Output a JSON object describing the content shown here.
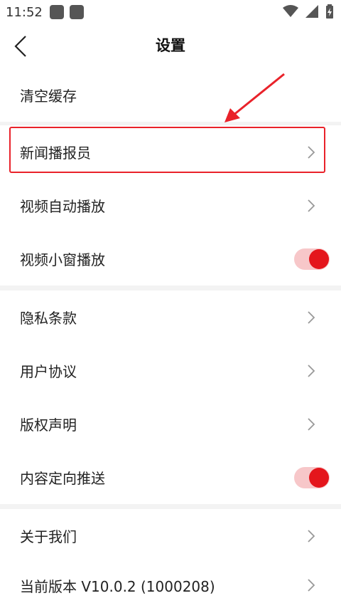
{
  "status_bar": {
    "time": "11:52"
  },
  "header": {
    "title": "设置"
  },
  "rows": [
    {
      "label": "清空缓存"
    },
    {
      "label": "新闻播报员"
    },
    {
      "label": "视频自动播放"
    },
    {
      "label": "视频小窗播放",
      "toggle_on": true
    },
    {
      "label": "隐私条款"
    },
    {
      "label": "用户协议"
    },
    {
      "label": "版权声明"
    },
    {
      "label": "内容定向推送",
      "toggle_on": true
    },
    {
      "label": "关于我们"
    },
    {
      "label": "当前版本 V10.0.2 (1000208)"
    }
  ],
  "colors": {
    "accent": "#e4161c",
    "toggle_track": "#f7c7c9",
    "annotation": "#e9222a"
  }
}
